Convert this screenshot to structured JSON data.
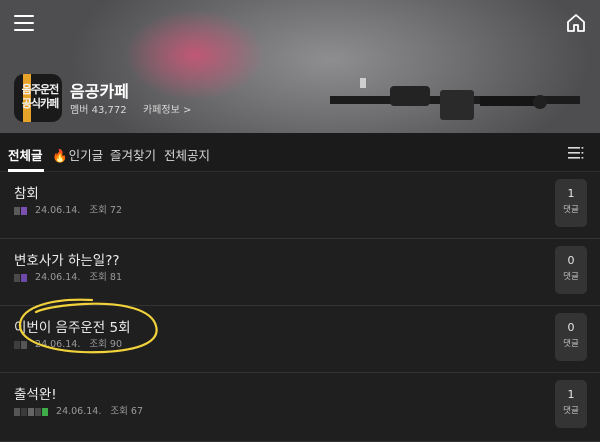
{
  "header": {
    "menu_icon": "hamburger-menu-icon",
    "home_icon": "home-icon",
    "logo_lines": [
      "음주운전",
      "공식카페"
    ],
    "cafe_name": "음공카페",
    "member_label": "멤버",
    "member_count": "43,772",
    "info_link": "카페정보 >"
  },
  "tabs": [
    {
      "label": "전체글",
      "active": true
    },
    {
      "label": "인기글",
      "icon": "fire-icon",
      "icon_glyph": "🔥"
    },
    {
      "label": "즐겨찾기"
    },
    {
      "label": "전체공지"
    }
  ],
  "list_view_icon": "list-view-icon",
  "posts": [
    {
      "title": "참회",
      "date": "24.06.14.",
      "views_label": "조회",
      "views": "72",
      "comments": "1",
      "comments_label": "댓글"
    },
    {
      "title": "변호사가 하는일??",
      "date": "24.06.14.",
      "views_label": "조회",
      "views": "81",
      "comments": "0",
      "comments_label": "댓글"
    },
    {
      "title": "이번이 음주운전 5회",
      "date": "24.06.14.",
      "views_label": "조회",
      "views": "90",
      "comments": "0",
      "comments_label": "댓글"
    },
    {
      "title": "출석완!",
      "date": "24.06.14.",
      "views_label": "조회",
      "views": "67",
      "comments": "1",
      "comments_label": "댓글"
    }
  ],
  "colors": {
    "background": "#1f1f1f",
    "accent_logo": "#e7a22a",
    "annotation": "#f2d23a",
    "fire": "#ff6a2b"
  }
}
